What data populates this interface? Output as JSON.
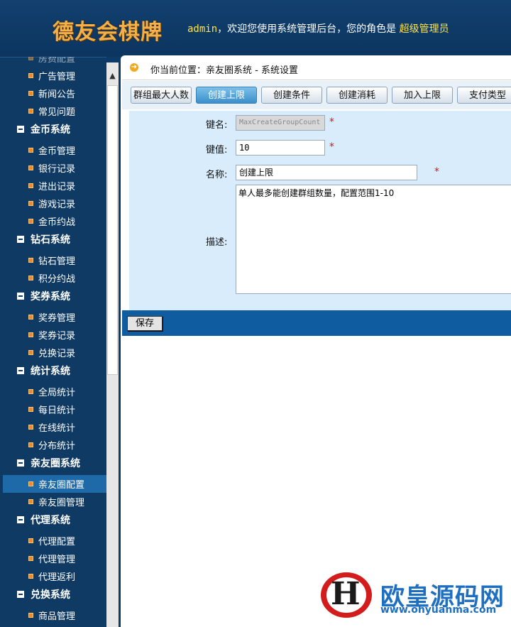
{
  "header": {
    "logo": "德友会棋牌",
    "user": "admin",
    "welcome_text": "，欢迎您使用系统管理后台，您的角色是",
    "role": "超级管理员"
  },
  "sidebar": {
    "items": [
      {
        "type": "item",
        "label": "房费配置",
        "y": -2
      },
      {
        "type": "item",
        "label": "广告管理"
      },
      {
        "type": "item",
        "label": "新闻公告"
      },
      {
        "type": "item",
        "label": "常见问题"
      },
      {
        "type": "group",
        "label": "金币系统"
      },
      {
        "type": "item",
        "label": "金币管理"
      },
      {
        "type": "item",
        "label": "银行记录"
      },
      {
        "type": "item",
        "label": "进出记录"
      },
      {
        "type": "item",
        "label": "游戏记录"
      },
      {
        "type": "item",
        "label": "金币约战"
      },
      {
        "type": "group",
        "label": "钻石系统"
      },
      {
        "type": "item",
        "label": "钻石管理"
      },
      {
        "type": "item",
        "label": "积分约战"
      },
      {
        "type": "group",
        "label": "奖券系统"
      },
      {
        "type": "item",
        "label": "奖券管理"
      },
      {
        "type": "item",
        "label": "奖券记录"
      },
      {
        "type": "item",
        "label": "兑换记录"
      },
      {
        "type": "group",
        "label": "统计系统"
      },
      {
        "type": "item",
        "label": "全局统计"
      },
      {
        "type": "item",
        "label": "每日统计"
      },
      {
        "type": "item",
        "label": "在线统计"
      },
      {
        "type": "item",
        "label": "分布统计"
      },
      {
        "type": "group",
        "label": "亲友圈系统"
      },
      {
        "type": "item",
        "label": "亲友圈配置",
        "active": true
      },
      {
        "type": "item",
        "label": "亲友圈管理"
      },
      {
        "type": "group",
        "label": "代理系统"
      },
      {
        "type": "item",
        "label": "代理配置"
      },
      {
        "type": "item",
        "label": "代理管理"
      },
      {
        "type": "item",
        "label": "代理返利"
      },
      {
        "type": "group",
        "label": "兑换系统"
      },
      {
        "type": "item",
        "label": "商品管理"
      }
    ]
  },
  "breadcrumb": "你当前位置：亲友圈系统 - 系统设置",
  "tabs": [
    {
      "label": "群组最大人数"
    },
    {
      "label": "创建上限",
      "active": true
    },
    {
      "label": "创建条件"
    },
    {
      "label": "创建消耗"
    },
    {
      "label": "加入上限"
    },
    {
      "label": "支付类型"
    }
  ],
  "form": {
    "key_label": "键名:",
    "key_value": "MaxCreateGroupCount",
    "val_label": "键值:",
    "val_value": "10",
    "name_label": "名称:",
    "name_value": "创建上限",
    "desc_label": "描述:",
    "desc_value": "单人最多能创建群组数量，配置范围1-10",
    "required_mark": "*"
  },
  "save_label": "保存",
  "watermark": {
    "logo_letter": "H",
    "brand": "欧皇源码网",
    "url": "www.ohyuanma.com"
  }
}
